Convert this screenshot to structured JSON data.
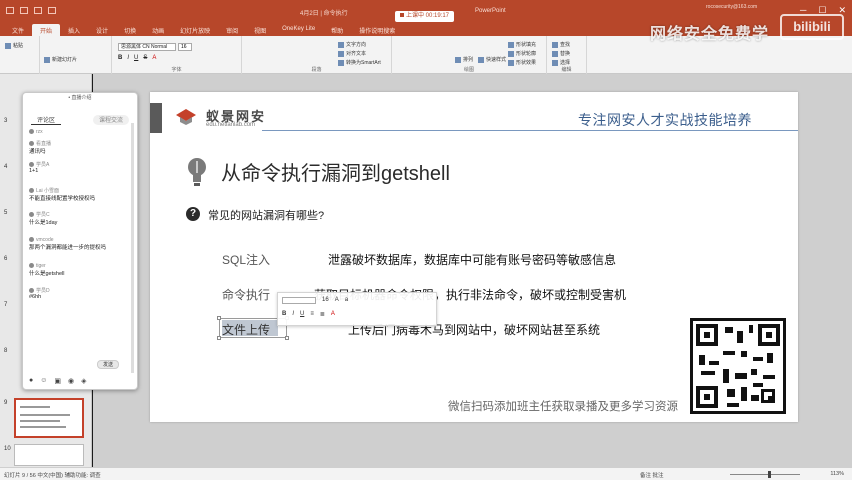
{
  "titlebar": {
    "doc_title": "4月2日 | 命令执行",
    "recording": "上课中 00:19:17",
    "app_name": "PowerPoint",
    "user": "rocosecurity@163.com"
  },
  "ribbon_tabs": [
    "文件",
    "开始",
    "插入",
    "设计",
    "切换",
    "动画",
    "幻灯片放映",
    "审阅",
    "视图",
    "OneKey Lite",
    "帮助",
    "操作说明搜索"
  ],
  "ribbon": {
    "paste": "粘贴",
    "new_slide": "新建幻灯片",
    "font": "思源黑体 CN Normal",
    "font_size": "16",
    "font_group": "字体",
    "paragraph_group": "段落",
    "text_direction": "文字方向",
    "align_text": "对齐文本",
    "smartart": "转换为SmartArt",
    "drawing_group": "绘图",
    "shape_fill": "形状填充",
    "shape_outline": "形状轮廓",
    "shape_effects": "形状效果",
    "arrange": "排列",
    "quick_styles": "快速样式",
    "find": "查找",
    "replace": "替换",
    "select": "选择",
    "editing_group": "编辑",
    "format_bold": "B",
    "format_italic": "I",
    "format_underline": "U",
    "format_strike": "S",
    "format_color": "A"
  },
  "watermark": {
    "text": "网络安全免费学",
    "logo": "bilibili"
  },
  "thumbs": {
    "numbers": [
      "3",
      "4",
      "5",
      "6",
      "7",
      "8",
      "9",
      "10"
    ]
  },
  "chat": {
    "top": "• 直播介绍",
    "tab_active": "评论区",
    "tab_other": "课程交流",
    "messages": [
      {
        "who": "rzx",
        "txt": ""
      },
      {
        "who": "看直播",
        "txt": "通讯吗"
      },
      {
        "who": "学员A",
        "txt": "1+1"
      },
      {
        "who": "Lai 小雪面",
        "txt": "不能直接线配置学校授权吗"
      },
      {
        "who": "学员C",
        "txt": "什么是1day"
      },
      {
        "who": "vmcode",
        "txt": "那两个漏洞都能进一步的提权吗"
      },
      {
        "who": "tiger",
        "txt": "什么是getshell"
      },
      {
        "who": "学员D",
        "txt": "#6hh"
      }
    ],
    "send": "发送"
  },
  "slide": {
    "brand_name": "蚁景网安",
    "brand_url": "edu.hetianlab.com",
    "slogan": "专注网安人才实战技能培养",
    "title": "从命令执行漏洞到getshell",
    "question": "常见的网站漏洞有哪些?",
    "rows": [
      {
        "label": "SQL注入",
        "desc": "泄露破坏数据库，数据库中可能有账号密码等敏感信息"
      },
      {
        "label": "命令执行",
        "desc": "获取目标机器命令权限，执行非法命令，破坏或控制受害机"
      },
      {
        "label": "文件上传",
        "desc": "上传后门病毒木马到网站中，破坏网站甚至系统"
      }
    ],
    "qr_caption": "微信扫码添加班主任获取录播及更多学习资源"
  },
  "statusbar": {
    "left": "幻灯片 9 / 56   中文(中国)   辅助功能: 调查",
    "notes": "备注   批注",
    "zoom": "113%"
  },
  "colors": {
    "accent": "#b7472a",
    "slogan": "#3b5e8c"
  }
}
